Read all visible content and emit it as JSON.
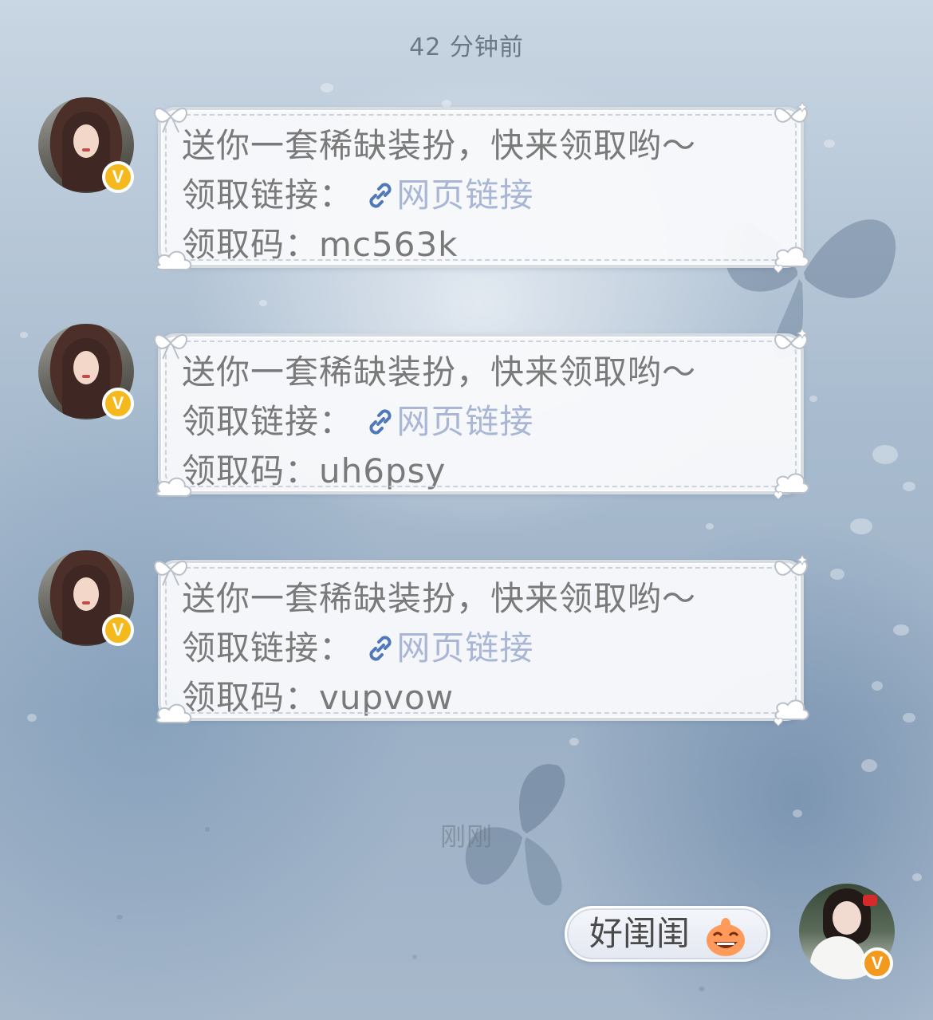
{
  "timestamps": {
    "top": "42 分钟前",
    "recent": "刚刚"
  },
  "messages": [
    {
      "line1": "送你一套稀缺装扮，快来领取哟～",
      "link_prefix": "领取链接：",
      "link_text": "网页链接",
      "code_prefix": "领取码：",
      "code": "mc563k"
    },
    {
      "line1": "送你一套稀缺装扮，快来领取哟～",
      "link_prefix": "领取链接：",
      "link_text": "网页链接",
      "code_prefix": "领取码：",
      "code": "uh6psy"
    },
    {
      "line1": "送你一套稀缺装扮，快来领取哟～",
      "link_prefix": "领取链接：",
      "link_text": "网页链接",
      "code_prefix": "领取码：",
      "code": "vupvow"
    }
  ],
  "reply": {
    "text": "好闺闺",
    "emoji": "grinning-sticker-icon"
  },
  "badge": {
    "letter": "V",
    "color_other": "#f5b91e",
    "color_self": "#f39a1e"
  },
  "colors": {
    "link": "#a9b6d6",
    "link_icon": "#4f78b8",
    "message_text": "#7a7a7a"
  }
}
